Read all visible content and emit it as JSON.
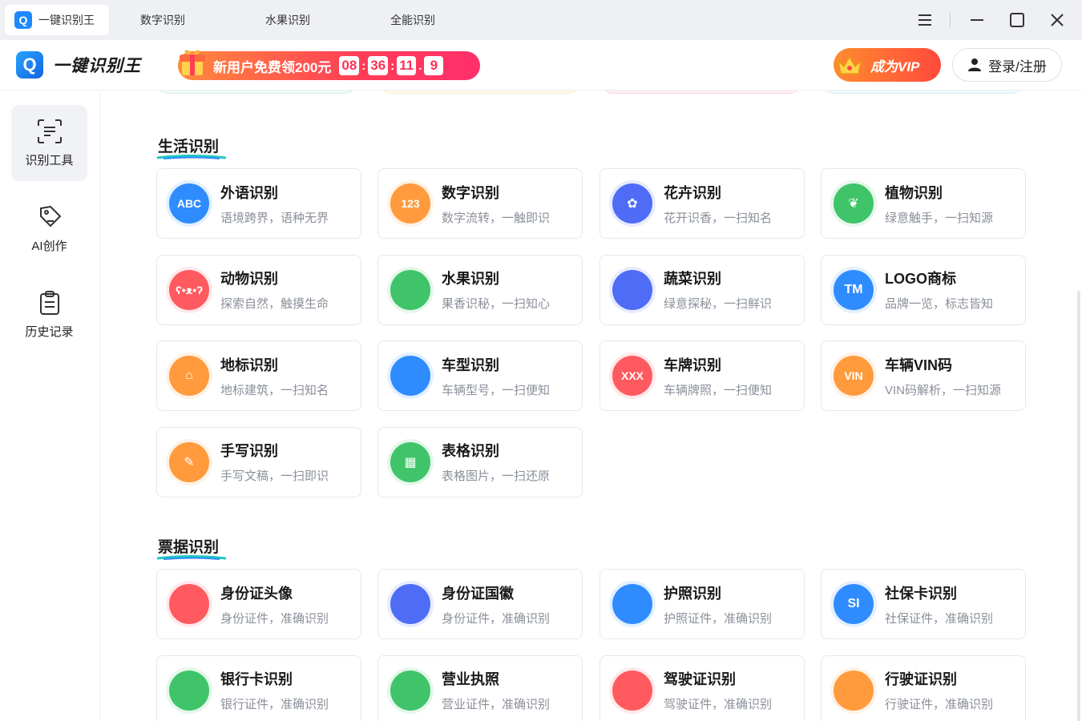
{
  "tabs": [
    {
      "label": "一键识别王",
      "active": true
    },
    {
      "label": "数字识别",
      "active": false
    },
    {
      "label": "水果识别",
      "active": false
    },
    {
      "label": "全能识别",
      "active": false
    }
  ],
  "header": {
    "app_name": "一键识别王",
    "promo_text": "新用户免费领200元",
    "countdown": [
      "08",
      "36",
      "11",
      "9"
    ],
    "vip_label": "成为VIP",
    "login_label": "登录/注册"
  },
  "sidebar": {
    "items": [
      {
        "label": "识别工具",
        "icon": "scan-icon",
        "active": true
      },
      {
        "label": "AI创作",
        "icon": "pen-tag-icon",
        "active": false
      },
      {
        "label": "历史记录",
        "icon": "clipboard-icon",
        "active": false
      }
    ]
  },
  "sections": [
    {
      "title": "生活识别",
      "cards": [
        {
          "title": "外语识别",
          "desc": "语境跨界，语种无界",
          "icon": "abc-icon",
          "glyph": "ABC",
          "color": "#2f8cff"
        },
        {
          "title": "数字识别",
          "desc": "数字流转，一触即识",
          "icon": "number-icon",
          "glyph": "123",
          "color": "#ff9a3d"
        },
        {
          "title": "花卉识别",
          "desc": "花开识香，一扫知名",
          "icon": "flower-icon",
          "glyph": "✿",
          "color": "#4f6cf7"
        },
        {
          "title": "植物识别",
          "desc": "绿意触手，一扫知源",
          "icon": "leaf-icon",
          "glyph": "❦",
          "color": "#3fc46a"
        },
        {
          "title": "动物识别",
          "desc": "探索自然，触摸生命",
          "icon": "bear-icon",
          "glyph": "ʕ•ᴥ•ʔ",
          "color": "#ff5a5f"
        },
        {
          "title": "水果识别",
          "desc": "果香识秘，一扫知心",
          "icon": "apple-icon",
          "glyph": "",
          "color": "#3fc46a"
        },
        {
          "title": "蔬菜识别",
          "desc": "绿意探秘，一扫鲜识",
          "icon": "vegetable-icon",
          "glyph": "",
          "color": "#4f6cf7"
        },
        {
          "title": "LOGO商标",
          "desc": "品牌一览，标志皆知",
          "icon": "trademark-icon",
          "glyph": "TM",
          "color": "#2f8cff"
        },
        {
          "title": "地标识别",
          "desc": "地标建筑，一扫知名",
          "icon": "building-icon",
          "glyph": "⌂",
          "color": "#ff9a3d"
        },
        {
          "title": "车型识别",
          "desc": "车辆型号，一扫便知",
          "icon": "car-icon",
          "glyph": "",
          "color": "#2f8cff"
        },
        {
          "title": "车牌识别",
          "desc": "车辆牌照，一扫便知",
          "icon": "plate-icon",
          "glyph": "XXX",
          "color": "#ff5a5f"
        },
        {
          "title": "车辆VIN码",
          "desc": "VIN码解析，一扫知源",
          "icon": "vin-icon",
          "glyph": "VIN",
          "color": "#ff9a3d"
        },
        {
          "title": "手写识别",
          "desc": "手写文稿，一扫即识",
          "icon": "handwriting-icon",
          "glyph": "✎",
          "color": "#ff9a3d"
        },
        {
          "title": "表格识别",
          "desc": "表格图片，一扫还原",
          "icon": "table-icon",
          "glyph": "▦",
          "color": "#3fc46a"
        }
      ]
    },
    {
      "title": "票据识别",
      "cards": [
        {
          "title": "身份证头像",
          "desc": "身份证件，准确识别",
          "icon": "id-card-front-icon",
          "glyph": "",
          "color": "#ff5a5f"
        },
        {
          "title": "身份证国徽",
          "desc": "身份证件，准确识别",
          "icon": "id-card-emblem-icon",
          "glyph": "",
          "color": "#4f6cf7"
        },
        {
          "title": "护照识别",
          "desc": "护照证件，准确识别",
          "icon": "passport-icon",
          "glyph": "",
          "color": "#2f8cff"
        },
        {
          "title": "社保卡识别",
          "desc": "社保证件，准确识别",
          "icon": "social-card-icon",
          "glyph": "SI",
          "color": "#2f8cff"
        },
        {
          "title": "银行卡识别",
          "desc": "银行证件，准确识别",
          "icon": "bank-card-icon",
          "glyph": "",
          "color": "#3fc46a"
        },
        {
          "title": "营业执照",
          "desc": "营业证件，准确识别",
          "icon": "license-icon",
          "glyph": "",
          "color": "#3fc46a"
        },
        {
          "title": "驾驶证识别",
          "desc": "驾驶证件，准确识别",
          "icon": "driver-license-icon",
          "glyph": "",
          "color": "#ff5a5f"
        },
        {
          "title": "行驶证识别",
          "desc": "行驶证件，准确识别",
          "icon": "vehicle-license-icon",
          "glyph": "",
          "color": "#ff9a3d"
        }
      ]
    }
  ]
}
